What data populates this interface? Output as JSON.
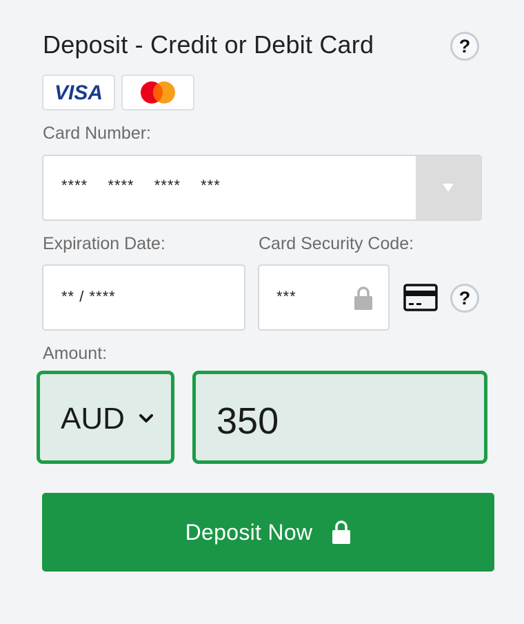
{
  "header": {
    "title": "Deposit - Credit or Debit Card",
    "help_label": "?"
  },
  "card_logos": {
    "visa": "VISA",
    "mastercard_icon": "mastercard-logo-icon"
  },
  "card_number": {
    "label": "Card Number:",
    "value": "**** **** **** ***",
    "dropdown_icon": "triangle-down-icon"
  },
  "expiration": {
    "label": "Expiration Date:",
    "value": "** / ****"
  },
  "security_code": {
    "label": "Card Security Code:",
    "value": "***",
    "lock_icon": "lock-icon",
    "card_icon": "credit-card-icon",
    "help_label": "?"
  },
  "amount": {
    "label": "Amount:",
    "currency": "AUD",
    "value": "350"
  },
  "deposit_button": {
    "label": "Deposit Now",
    "icon": "lock-icon"
  },
  "colors": {
    "accent_green": "#1b9646",
    "amount_border": "#1d9c47",
    "amount_bg": "#dfece7",
    "page_bg": "#f3f4f6"
  }
}
